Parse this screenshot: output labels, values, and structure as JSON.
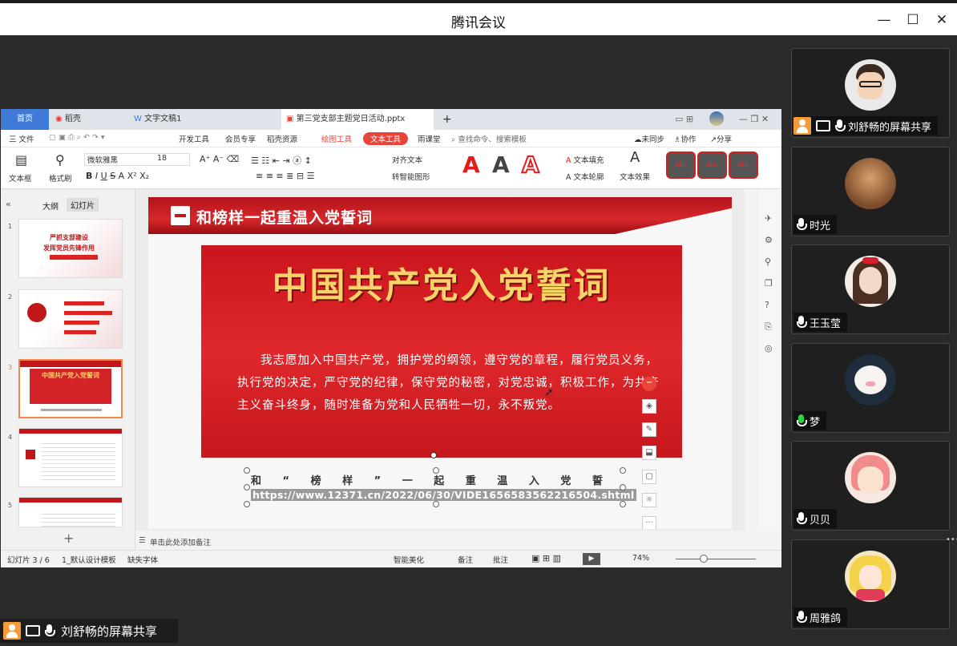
{
  "window": {
    "title": "腾讯会议",
    "minimize": "—",
    "maximize": "☐",
    "close": "✕"
  },
  "wps": {
    "tabs": [
      {
        "label": "首页"
      },
      {
        "label": "稻壳"
      },
      {
        "label": "文字文稿1"
      },
      {
        "label": "第三党支部主题党日活动.pptx"
      },
      {
        "label": "+"
      }
    ],
    "menu": {
      "file": "三 文件",
      "items": [
        "开发工具",
        "会员专享",
        "稻壳资源",
        "绘图工具",
        "文本工具",
        "雨课堂"
      ],
      "search": "查找命令、搜索模板",
      "sync": "未同步",
      "collab": "协作",
      "share": "分享"
    },
    "tools": {
      "textbox": "文本框",
      "format_painter": "格式刷",
      "font": "微软雅黑",
      "size": "18",
      "align_text": "对齐文本",
      "smart_shape": "转智能图形",
      "text_fill": "文本填充",
      "text_outline": "文本轮廓",
      "text_effect": "文本效果",
      "bigA": "A",
      "abc": "Abc"
    },
    "panel": {
      "outline": "大纲",
      "slides": "幻灯片",
      "add": "+"
    },
    "thumbs": [
      {
        "num": "1",
        "line1": "严抓支部建设",
        "line2": "发挥党员先锋作用"
      },
      {
        "num": "2"
      },
      {
        "num": "3",
        "title": "中国共产党入党誓词"
      },
      {
        "num": "4"
      },
      {
        "num": "5"
      }
    ],
    "slide": {
      "header": "和榜样一起重温入党誓词",
      "big_title": "中国共产党入党誓词",
      "oath": "我志愿加入中国共产党，拥护党的纲领，遵守党的章程，履行党员义务，执行党的决定，严守党的纪律，保守党的秘密，对党忠诚，积极工作，为共产主义奋斗终身，随时准备为党和人民牺牲一切，永不叛党。",
      "caption": "和 “ 榜 样 ” 一 起 重 温 入 党 誓 词 ：",
      "url": "https://www.12371.cn/2022/06/30/VIDE1656583562216504.shtml"
    },
    "notes": "单击此处添加备注",
    "status": {
      "slide_count": "幻灯片 3 / 6",
      "template": "1_默认设计模板",
      "missing_font": "缺失字体",
      "beautify": "智能美化",
      "notes": "备注",
      "comment": "批注",
      "zoom": "74%"
    }
  },
  "sharer_label": "刘舒畅的屏幕共享",
  "participants": [
    {
      "name": "刘舒畅的屏幕共享",
      "mic": "white",
      "sharing": true
    },
    {
      "name": "时光",
      "mic": "white"
    },
    {
      "name": "王玉莹",
      "mic": "white"
    },
    {
      "name": "梦",
      "mic": "green"
    },
    {
      "name": "贝贝",
      "mic": "white"
    },
    {
      "name": "周雅鸽",
      "mic": "white"
    }
  ],
  "colors": {
    "accent": "#3f7ad8",
    "wps_red": "#e8443a",
    "slide_red": "#d6282b",
    "title_gold": "#f7d36a",
    "mic_green": "#2fd33f"
  }
}
